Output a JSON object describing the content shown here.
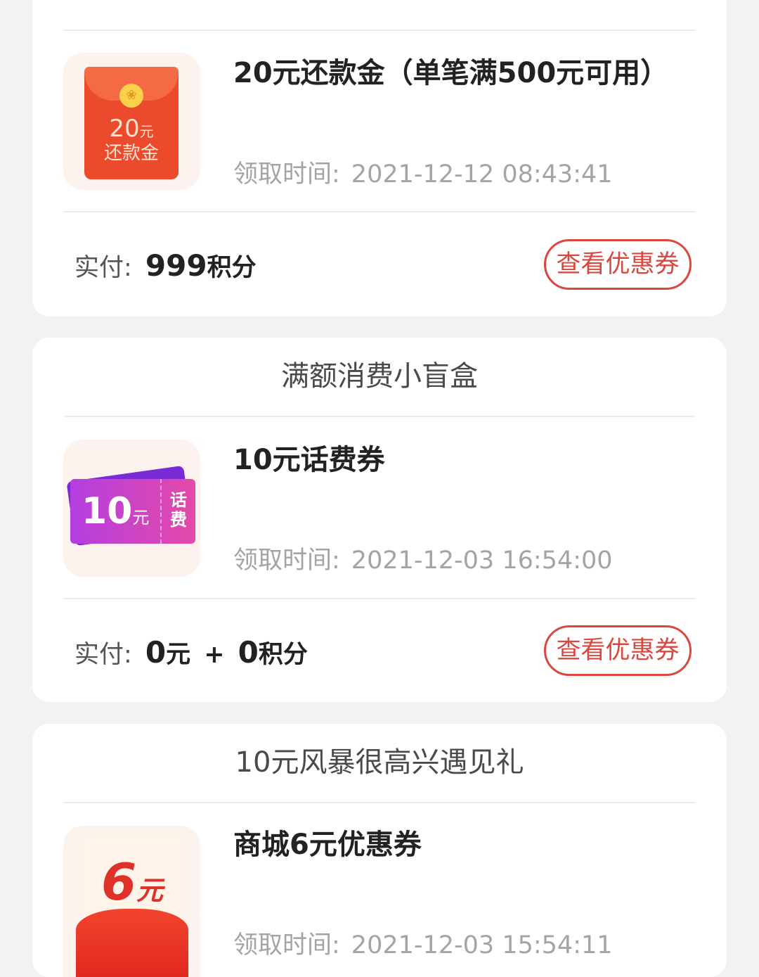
{
  "cards": [
    {
      "title": "",
      "item_name": "20元还款金（单笔满500元可用）",
      "thumb": {
        "amount": "20",
        "unit": "元",
        "label": "还款金",
        "icon": "red-envelope-icon"
      },
      "time_label": "领取时间:",
      "time_value": "2021-12-12 08:43:41",
      "pay_label": "实付:",
      "pay_points": "999",
      "points_unit": "积分",
      "button_label": "查看优惠券"
    },
    {
      "title": "满额消费小盲盒",
      "item_name": "10元话费券",
      "thumb": {
        "amount": "10",
        "unit": "元",
        "side_label_1": "话",
        "side_label_2": "费",
        "icon": "phone-coupon-icon"
      },
      "time_label": "领取时间:",
      "time_value": "2021-12-03 16:54:00",
      "pay_label": "实付:",
      "pay_cash": "0",
      "cash_unit": "元",
      "plus": "+",
      "pay_points": "0",
      "points_unit": "积分",
      "button_label": "查看优惠券"
    },
    {
      "title": "10元风暴很高兴遇见礼",
      "item_name": "商城6元优惠券",
      "thumb": {
        "amount": "6",
        "unit": "元",
        "icon": "mall-coupon-icon"
      },
      "time_label": "领取时间:",
      "time_value": "2021-12-03 15:54:11"
    }
  ],
  "colors": {
    "accent": "#d9473f",
    "background": "#f2f2f2",
    "card": "#ffffff"
  }
}
